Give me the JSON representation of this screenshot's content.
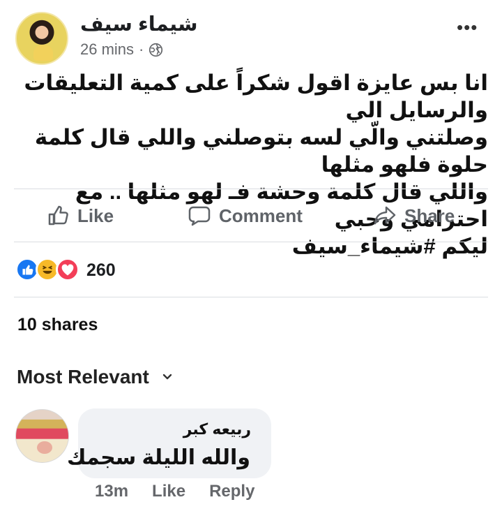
{
  "post": {
    "author": "شيماء سيف",
    "time": "26 mins",
    "separator": "·",
    "more": "•••",
    "text_lines": [
      "انا بس عايزة اقول شكراً على كمية التعليقات والرسايل الي",
      "وصلتني والّي لسه بتوصلني واللي قال كلمة حلوة فلهو مثلها",
      "واللي قال كلمة وحشة فـ لهو مثلها .. مع احترامي وحبي",
      "ليكم #شيماء_سيف"
    ]
  },
  "actions": {
    "like": "Like",
    "comment": "Comment",
    "share": "Share"
  },
  "reactions": {
    "count": "260",
    "icons": [
      "like-reaction-icon",
      "haha-reaction-icon",
      "love-reaction-icon"
    ],
    "colors": {
      "like": "#1877f2",
      "haha": "#f7b928",
      "love": "#f33e58"
    }
  },
  "shares": "10 shares",
  "comments_sort": {
    "label": "Most Relevant"
  },
  "comment": {
    "author": "ربيعه كبر",
    "text": "والله الليلة سجمك",
    "time": "13m",
    "like": "Like",
    "reply": "Reply"
  }
}
